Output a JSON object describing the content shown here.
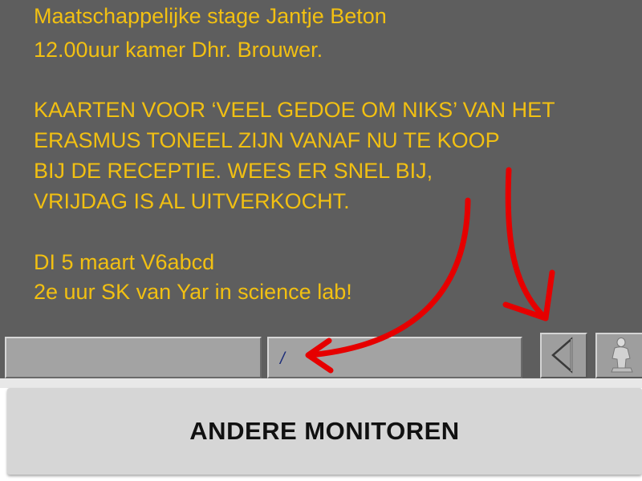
{
  "board": {
    "lines": [
      "Maatschappelijke stage Jantje Beton",
      "12.00uur kamer Dhr. Brouwer.",
      "KAARTEN VOOR ‘VEEL GEDOE OM NIKS’ VAN HET",
      "ERASMUS TONEEL ZIJN VANAF NU TE KOOP",
      "BIJ DE RECEPTIE. WEES ER SNEL BIJ,",
      "VRIJDAG IS AL UITVERKOCHT.",
      "DI 5 maart V6abcd",
      "2e uur SK van Yar in science lab!"
    ],
    "text_color": "#f2c012",
    "background_color": "#5e5e5e"
  },
  "controls": {
    "left_field_value": "",
    "middle_field_value": "/",
    "prev_icon": "triangle-left-icon",
    "next_icon": "statue-icon"
  },
  "annotation": {
    "arrow_color": "#e60000"
  },
  "footer": {
    "button_label": "ANDERE MONITOREN"
  }
}
